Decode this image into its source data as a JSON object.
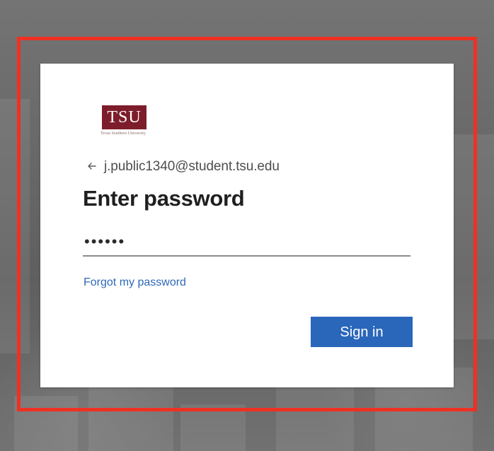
{
  "background": {
    "overlay_color": "#6e6e6e",
    "highlight_color": "#ef3024"
  },
  "brand": {
    "logo_text": "TSU",
    "subtitle": "Texas Southern University",
    "logo_color": "#7d1d2b"
  },
  "identity": {
    "icon": "arrow-left-icon",
    "email": "j.public1340@student.tsu.edu"
  },
  "page": {
    "title": "Enter password"
  },
  "password": {
    "value": "••••••",
    "type": "password"
  },
  "links": {
    "forgot_password": "Forgot my password",
    "link_color": "#2f69b8"
  },
  "actions": {
    "sign_in_label": "Sign in",
    "button_color": "#2a67bb"
  }
}
